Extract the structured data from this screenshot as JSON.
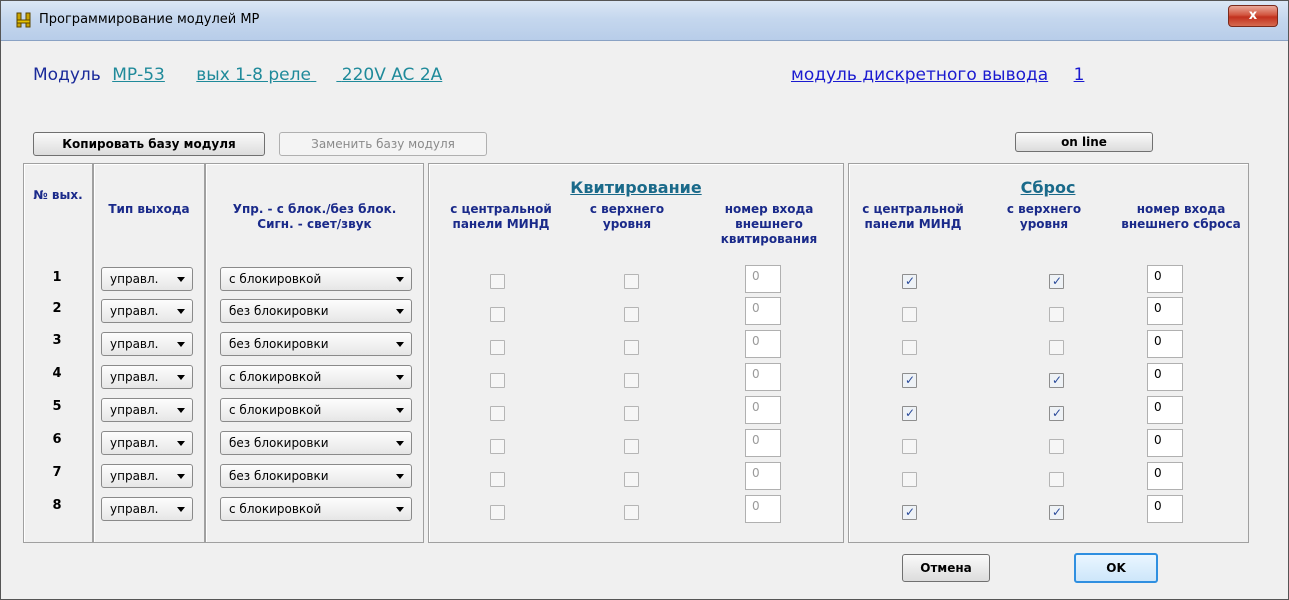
{
  "window": {
    "title": "Программирование модулей МР",
    "close_label": "x"
  },
  "header": {
    "module_label": "Модуль",
    "module_code": "МР-53",
    "module_desc": "вых 1-8 реле",
    "module_spec": "220V AC  2A",
    "module_type_link": "модуль дискретного вывода",
    "module_number": "1"
  },
  "toolbar": {
    "copy_label": "Копировать базу модуля",
    "replace_label": "Заменить базу модуля",
    "online_label": "on line"
  },
  "columns": {
    "num": "№ вых.",
    "type": "Тип выхода",
    "ctrl_line1": "Упр. -  с блок./без блок.",
    "ctrl_line2": "Сигн. -  свет/звук"
  },
  "ack": {
    "title": "Квитирование",
    "col1": "с центральной панели МИНД",
    "col2": "с верхнего уровня",
    "col3": "номер входа внешнего квитирования"
  },
  "reset": {
    "title": "Сброс",
    "col1": "с центральной панели МИНД",
    "col2": "с верхнего уровня",
    "col3": "номер входа внешнего сброса"
  },
  "rows": [
    {
      "num": "1",
      "type": "управл.",
      "mode": "с  блокировкой",
      "ack_input": "0",
      "reset_central": true,
      "reset_upper": true,
      "reset_input": "0"
    },
    {
      "num": "2",
      "type": "управл.",
      "mode": "без блокировки",
      "ack_input": "0",
      "reset_central": false,
      "reset_upper": false,
      "reset_input": "0"
    },
    {
      "num": "3",
      "type": "управл.",
      "mode": "без блокировки",
      "ack_input": "0",
      "reset_central": false,
      "reset_upper": false,
      "reset_input": "0"
    },
    {
      "num": "4",
      "type": "управл.",
      "mode": "с  блокировкой",
      "ack_input": "0",
      "reset_central": true,
      "reset_upper": true,
      "reset_input": "0"
    },
    {
      "num": "5",
      "type": "управл.",
      "mode": "с  блокировкой",
      "ack_input": "0",
      "reset_central": true,
      "reset_upper": true,
      "reset_input": "0"
    },
    {
      "num": "6",
      "type": "управл.",
      "mode": "без блокировки",
      "ack_input": "0",
      "reset_central": false,
      "reset_upper": false,
      "reset_input": "0"
    },
    {
      "num": "7",
      "type": "управл.",
      "mode": "без блокировки",
      "ack_input": "0",
      "reset_central": false,
      "reset_upper": false,
      "reset_input": "0"
    },
    {
      "num": "8",
      "type": "управл.",
      "mode": "с  блокировкой",
      "ack_input": "0",
      "reset_central": true,
      "reset_upper": true,
      "reset_input": "0"
    }
  ],
  "footer": {
    "cancel_label": "Отмена",
    "ok_label": "OK"
  }
}
